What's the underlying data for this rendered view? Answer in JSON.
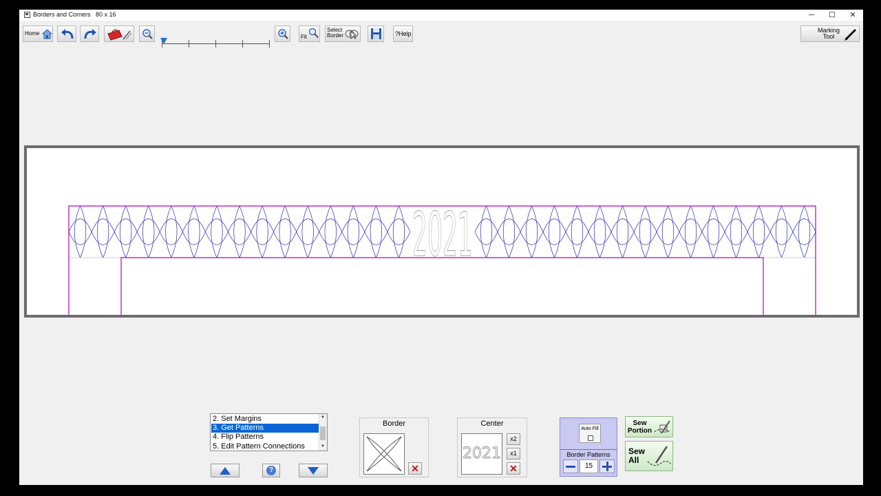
{
  "window": {
    "title": "Borders and Corners   80 x 16",
    "controls": {
      "minimize": "─",
      "maximize": "☐",
      "close": "✕"
    }
  },
  "toolbar": {
    "home_label": "Home",
    "fit_label": "Fit",
    "select_border_label": "Select\nBorder",
    "help_label": "?Help",
    "marking_tool_label": "Marking\nTool",
    "zoom_level": 0.0
  },
  "quilt": {
    "border_color": "#b400c8",
    "pattern_color": "#2828b4",
    "center_text": "2021"
  },
  "steps": {
    "items": [
      {
        "label": "2. Set Margins"
      },
      {
        "label": "3. Get Patterns"
      },
      {
        "label": "4. Flip Patterns"
      },
      {
        "label": "5. Edit Pattern Connections"
      }
    ],
    "selected_index": 1
  },
  "border_group": {
    "title": "Border"
  },
  "center_group": {
    "title": "Center",
    "preview_text": "2021",
    "x2_label": "x2",
    "x1_label": "x1"
  },
  "border_patterns": {
    "auto_fill_label": "Auto Fill",
    "title": "Border Patterns",
    "count": "15"
  },
  "sew": {
    "portion_label": "Sew\nPortion",
    "all_label": "Sew\nAll"
  }
}
